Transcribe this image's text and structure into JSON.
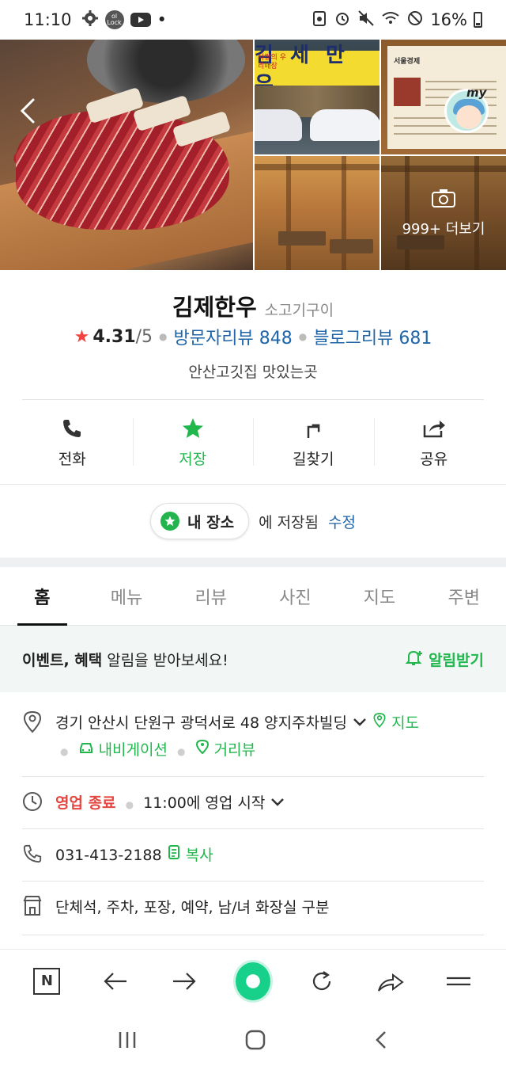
{
  "status_bar": {
    "time": "11:10",
    "lock_label": "ol Lock",
    "dot": "•",
    "battery": "16%"
  },
  "photos": {
    "sign_text": "김 세 만 우",
    "sign_sub": "사랑의 우리매장",
    "info_title": "서울경제",
    "more_label": "999+ 더보기",
    "my_badge": "my"
  },
  "place": {
    "name": "김제한우",
    "category": "소고기구이",
    "rating": "4.31",
    "rating_max": "/5",
    "visitor_reviews": "방문자리뷰 848",
    "blog_reviews": "블로그리뷰 681",
    "description": "안산고깃집 맛있는곳"
  },
  "actions": [
    {
      "label": "전화",
      "icon": "phone-icon"
    },
    {
      "label": "저장",
      "icon": "star-icon"
    },
    {
      "label": "길찾기",
      "icon": "directions-icon"
    },
    {
      "label": "공유",
      "icon": "share-icon"
    }
  ],
  "saved": {
    "chip": "내 장소",
    "text": "에 저장됨",
    "edit": "수정"
  },
  "tabs": [
    "홈",
    "메뉴",
    "리뷰",
    "사진",
    "지도",
    "주변"
  ],
  "event": {
    "bold": "이벤트, 혜택",
    "rest": " 알림을 받아보세요!",
    "notify": "알림받기"
  },
  "details": {
    "address": "경기 안산시 단원구 광덕서로 48 양지주차빌딩",
    "map": "지도",
    "navigation": "내비게이션",
    "street_view": "거리뷰",
    "status": "영업 종료",
    "hours": "11:00에 영업 시작",
    "phone": "031-413-2188",
    "copy": "복사",
    "amenities": "단체석, 주차, 포장, 예약, 남/녀 화장실 구분"
  },
  "browser": {
    "n_label": "N"
  }
}
